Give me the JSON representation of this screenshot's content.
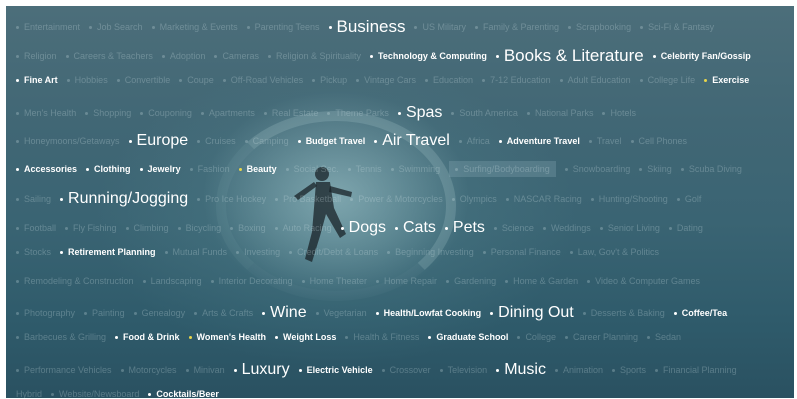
{
  "rows": [
    [
      {
        "text": "Entertainment",
        "w": "dim"
      },
      {
        "text": "Job Search",
        "w": "dim"
      },
      {
        "text": "Marketing & Events",
        "w": "dim"
      },
      {
        "text": "Parenting Teens",
        "w": "dim"
      },
      {
        "text": "Business",
        "w": "xl"
      },
      {
        "text": "US Military",
        "w": "dim"
      },
      {
        "text": "Family & Parenting",
        "w": "dim"
      },
      {
        "text": "Scrapbooking",
        "w": "dim"
      },
      {
        "text": "Sci-Fi & Fantasy",
        "w": "dim"
      }
    ],
    [
      {
        "text": "Religion",
        "w": "dim"
      },
      {
        "text": "Careers & Teachers",
        "w": "dim"
      },
      {
        "text": "Adoption",
        "w": "dim"
      },
      {
        "text": "Cameras",
        "w": "dim"
      },
      {
        "text": "Religion & Spirituality",
        "w": "dim"
      },
      {
        "text": "Technology & Computing",
        "w": "s"
      },
      {
        "text": "Books & Literature",
        "w": "xl"
      },
      {
        "text": "Celebrity Fan/Gossip",
        "w": "s"
      }
    ],
    [
      {
        "text": "Fine Art",
        "w": "s"
      },
      {
        "text": "Hobbies",
        "w": "dim"
      },
      {
        "text": "Convertible",
        "w": "dim"
      },
      {
        "text": "Coupe",
        "w": "dim"
      },
      {
        "text": "Off-Road Vehicles",
        "w": "dim"
      },
      {
        "text": "Pickup",
        "w": "dim"
      },
      {
        "text": "Vintage Cars",
        "w": "dim"
      },
      {
        "text": "Education",
        "w": "dim"
      },
      {
        "text": "7-12 Education",
        "w": "dim"
      },
      {
        "text": "Adult Education",
        "w": "dim"
      },
      {
        "text": "College Life",
        "w": "dim"
      },
      {
        "text": "Exercise",
        "w": "s",
        "dot": "y"
      }
    ],
    [
      {
        "text": "Men's Health",
        "w": "dim"
      },
      {
        "text": "Shopping",
        "w": "dim"
      },
      {
        "text": "Couponing",
        "w": "dim"
      },
      {
        "text": "Apartments",
        "w": "dim"
      },
      {
        "text": "Real Estate",
        "w": "dim"
      },
      {
        "text": "Theme Parks",
        "w": "dim"
      },
      {
        "text": "Spas",
        "w": "l"
      },
      {
        "text": "South America",
        "w": "dim"
      },
      {
        "text": "National Parks",
        "w": "dim"
      },
      {
        "text": "Hotels",
        "w": "dim"
      }
    ],
    [
      {
        "text": "Honeymoons/Getaways",
        "w": "dim"
      },
      {
        "text": "Europe",
        "w": "l"
      },
      {
        "text": "Cruises",
        "w": "dim"
      },
      {
        "text": "Camping",
        "w": "dim"
      },
      {
        "text": "Budget Travel",
        "w": "s"
      },
      {
        "text": "Air Travel",
        "w": "l"
      },
      {
        "text": "Africa",
        "w": "dim"
      },
      {
        "text": "Adventure Travel",
        "w": "s"
      },
      {
        "text": "Travel",
        "w": "dim"
      },
      {
        "text": "Cell Phones",
        "w": "dim"
      }
    ],
    [
      {
        "text": "Accessories",
        "w": "s"
      },
      {
        "text": "Clothing",
        "w": "s"
      },
      {
        "text": "Jewelry",
        "w": "s"
      },
      {
        "text": "Fashion",
        "w": "dim"
      },
      {
        "text": "Beauty",
        "w": "s",
        "dot": "y"
      },
      {
        "text": "Social Sec.",
        "w": "dim"
      },
      {
        "text": "Tennis",
        "w": "dim"
      },
      {
        "text": "Swimming",
        "w": "dim"
      },
      {
        "text": "Surfing/Bodyboarding",
        "w": "sel"
      },
      {
        "text": "Snowboarding",
        "w": "dim"
      },
      {
        "text": "Skiing",
        "w": "dim"
      },
      {
        "text": "Scuba Diving",
        "w": "dim"
      }
    ],
    [
      {
        "text": "Sailing",
        "w": "dim"
      },
      {
        "text": "Running/Jogging",
        "w": "l"
      },
      {
        "text": "Pro Ice Hockey",
        "w": "dim"
      },
      {
        "text": "Pro Basketball",
        "w": "dim"
      },
      {
        "text": "Power & Motorcycles",
        "w": "dim"
      },
      {
        "text": "Olympics",
        "w": "dim"
      },
      {
        "text": "NASCAR Racing",
        "w": "dim"
      },
      {
        "text": "Hunting/Shooting",
        "w": "dim"
      },
      {
        "text": "Golf",
        "w": "dim"
      }
    ],
    [
      {
        "text": "Football",
        "w": "dim"
      },
      {
        "text": "Fly Fishing",
        "w": "dim"
      },
      {
        "text": "Climbing",
        "w": "dim"
      },
      {
        "text": "Bicycling",
        "w": "dim"
      },
      {
        "text": "Boxing",
        "w": "dim"
      },
      {
        "text": "Auto Racing",
        "w": "dim"
      },
      {
        "text": "Dogs",
        "w": "l"
      },
      {
        "text": "Cats",
        "w": "l"
      },
      {
        "text": "Pets",
        "w": "l"
      },
      {
        "text": "Science",
        "w": "dim"
      },
      {
        "text": "Weddings",
        "w": "dim"
      },
      {
        "text": "Senior Living",
        "w": "dim"
      },
      {
        "text": "Dating",
        "w": "dim"
      }
    ],
    [
      {
        "text": "Stocks",
        "w": "dim"
      },
      {
        "text": "Retirement Planning",
        "w": "s"
      },
      {
        "text": "Mutual Funds",
        "w": "dim"
      },
      {
        "text": "Investing",
        "w": "dim"
      },
      {
        "text": "Credit/Debt & Loans",
        "w": "dim"
      },
      {
        "text": "Beginning Investing",
        "w": "dim"
      },
      {
        "text": "Personal Finance",
        "w": "dim"
      },
      {
        "text": "Law, Gov't & Politics",
        "w": "dim"
      }
    ],
    [
      {
        "text": "Remodeling & Construction",
        "w": "dim"
      },
      {
        "text": "Landscaping",
        "w": "dim"
      },
      {
        "text": "Interior Decorating",
        "w": "dim"
      },
      {
        "text": "Home Theater",
        "w": "dim"
      },
      {
        "text": "Home Repair",
        "w": "dim"
      },
      {
        "text": "Gardening",
        "w": "dim"
      },
      {
        "text": "Home & Garden",
        "w": "dim"
      },
      {
        "text": "Video & Computer Games",
        "w": "dim"
      }
    ],
    [
      {
        "text": "Photography",
        "w": "dim"
      },
      {
        "text": "Painting",
        "w": "dim"
      },
      {
        "text": "Genealogy",
        "w": "dim"
      },
      {
        "text": "Arts & Crafts",
        "w": "dim"
      },
      {
        "text": "Wine",
        "w": "l"
      },
      {
        "text": "Vegetarian",
        "w": "dim"
      },
      {
        "text": "Health/Lowfat Cooking",
        "w": "s"
      },
      {
        "text": "Dining Out",
        "w": "l"
      },
      {
        "text": "Desserts & Baking",
        "w": "dim"
      },
      {
        "text": "Coffee/Tea",
        "w": "s"
      }
    ],
    [
      {
        "text": "Barbecues & Grilling",
        "w": "dim"
      },
      {
        "text": "Food & Drink",
        "w": "s"
      },
      {
        "text": "Women's Health",
        "w": "s",
        "dot": "y"
      },
      {
        "text": "Weight Loss",
        "w": "s"
      },
      {
        "text": "Health & Fitness",
        "w": "dim"
      },
      {
        "text": "Graduate School",
        "w": "s"
      },
      {
        "text": "College",
        "w": "dim"
      },
      {
        "text": "Career Planning",
        "w": "dim"
      },
      {
        "text": "Sedan",
        "w": "dim"
      }
    ],
    [
      {
        "text": "Performance Vehicles",
        "w": "dim"
      },
      {
        "text": "Motorcycles",
        "w": "dim"
      },
      {
        "text": "Minivan",
        "w": "dim"
      },
      {
        "text": "Luxury",
        "w": "l"
      },
      {
        "text": "Electric Vehicle",
        "w": "s"
      },
      {
        "text": "Crossover",
        "w": "dim"
      },
      {
        "text": "Television",
        "w": "dim"
      },
      {
        "text": "Music",
        "w": "l"
      },
      {
        "text": "Animation",
        "w": "dim"
      },
      {
        "text": "Sports",
        "w": "dim"
      },
      {
        "text": "Financial Planning",
        "w": "dim"
      }
    ],
    [
      {
        "text": "Hybrid",
        "w": "dim",
        "noDot": true
      },
      {
        "text": "Website/Newsboard",
        "w": "dim"
      },
      {
        "text": "Cocktails/Beer",
        "w": "s"
      }
    ]
  ]
}
